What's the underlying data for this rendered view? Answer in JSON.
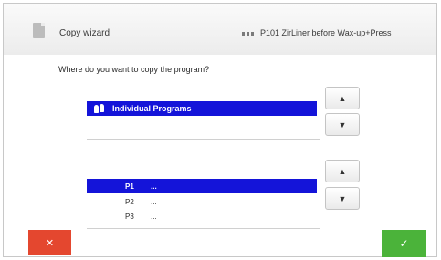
{
  "header": {
    "title": "Copy wizard",
    "program_name": "P101 ZirLiner before Wax-up+Press"
  },
  "prompt": {
    "question": "Where do you want to copy the program?"
  },
  "groups": {
    "selected_label": "Individual Programs"
  },
  "programs": [
    {
      "num": "P1",
      "name": "..."
    },
    {
      "num": "P2",
      "name": "..."
    },
    {
      "num": "P3",
      "name": "..."
    }
  ],
  "buttons": {
    "up_glyph": "▲",
    "down_glyph": "▼",
    "cancel_glyph": "✕",
    "confirm_glyph": "✓"
  },
  "colors": {
    "selection": "#1414d9",
    "cancel": "#e4472f",
    "confirm": "#4bb33a"
  }
}
